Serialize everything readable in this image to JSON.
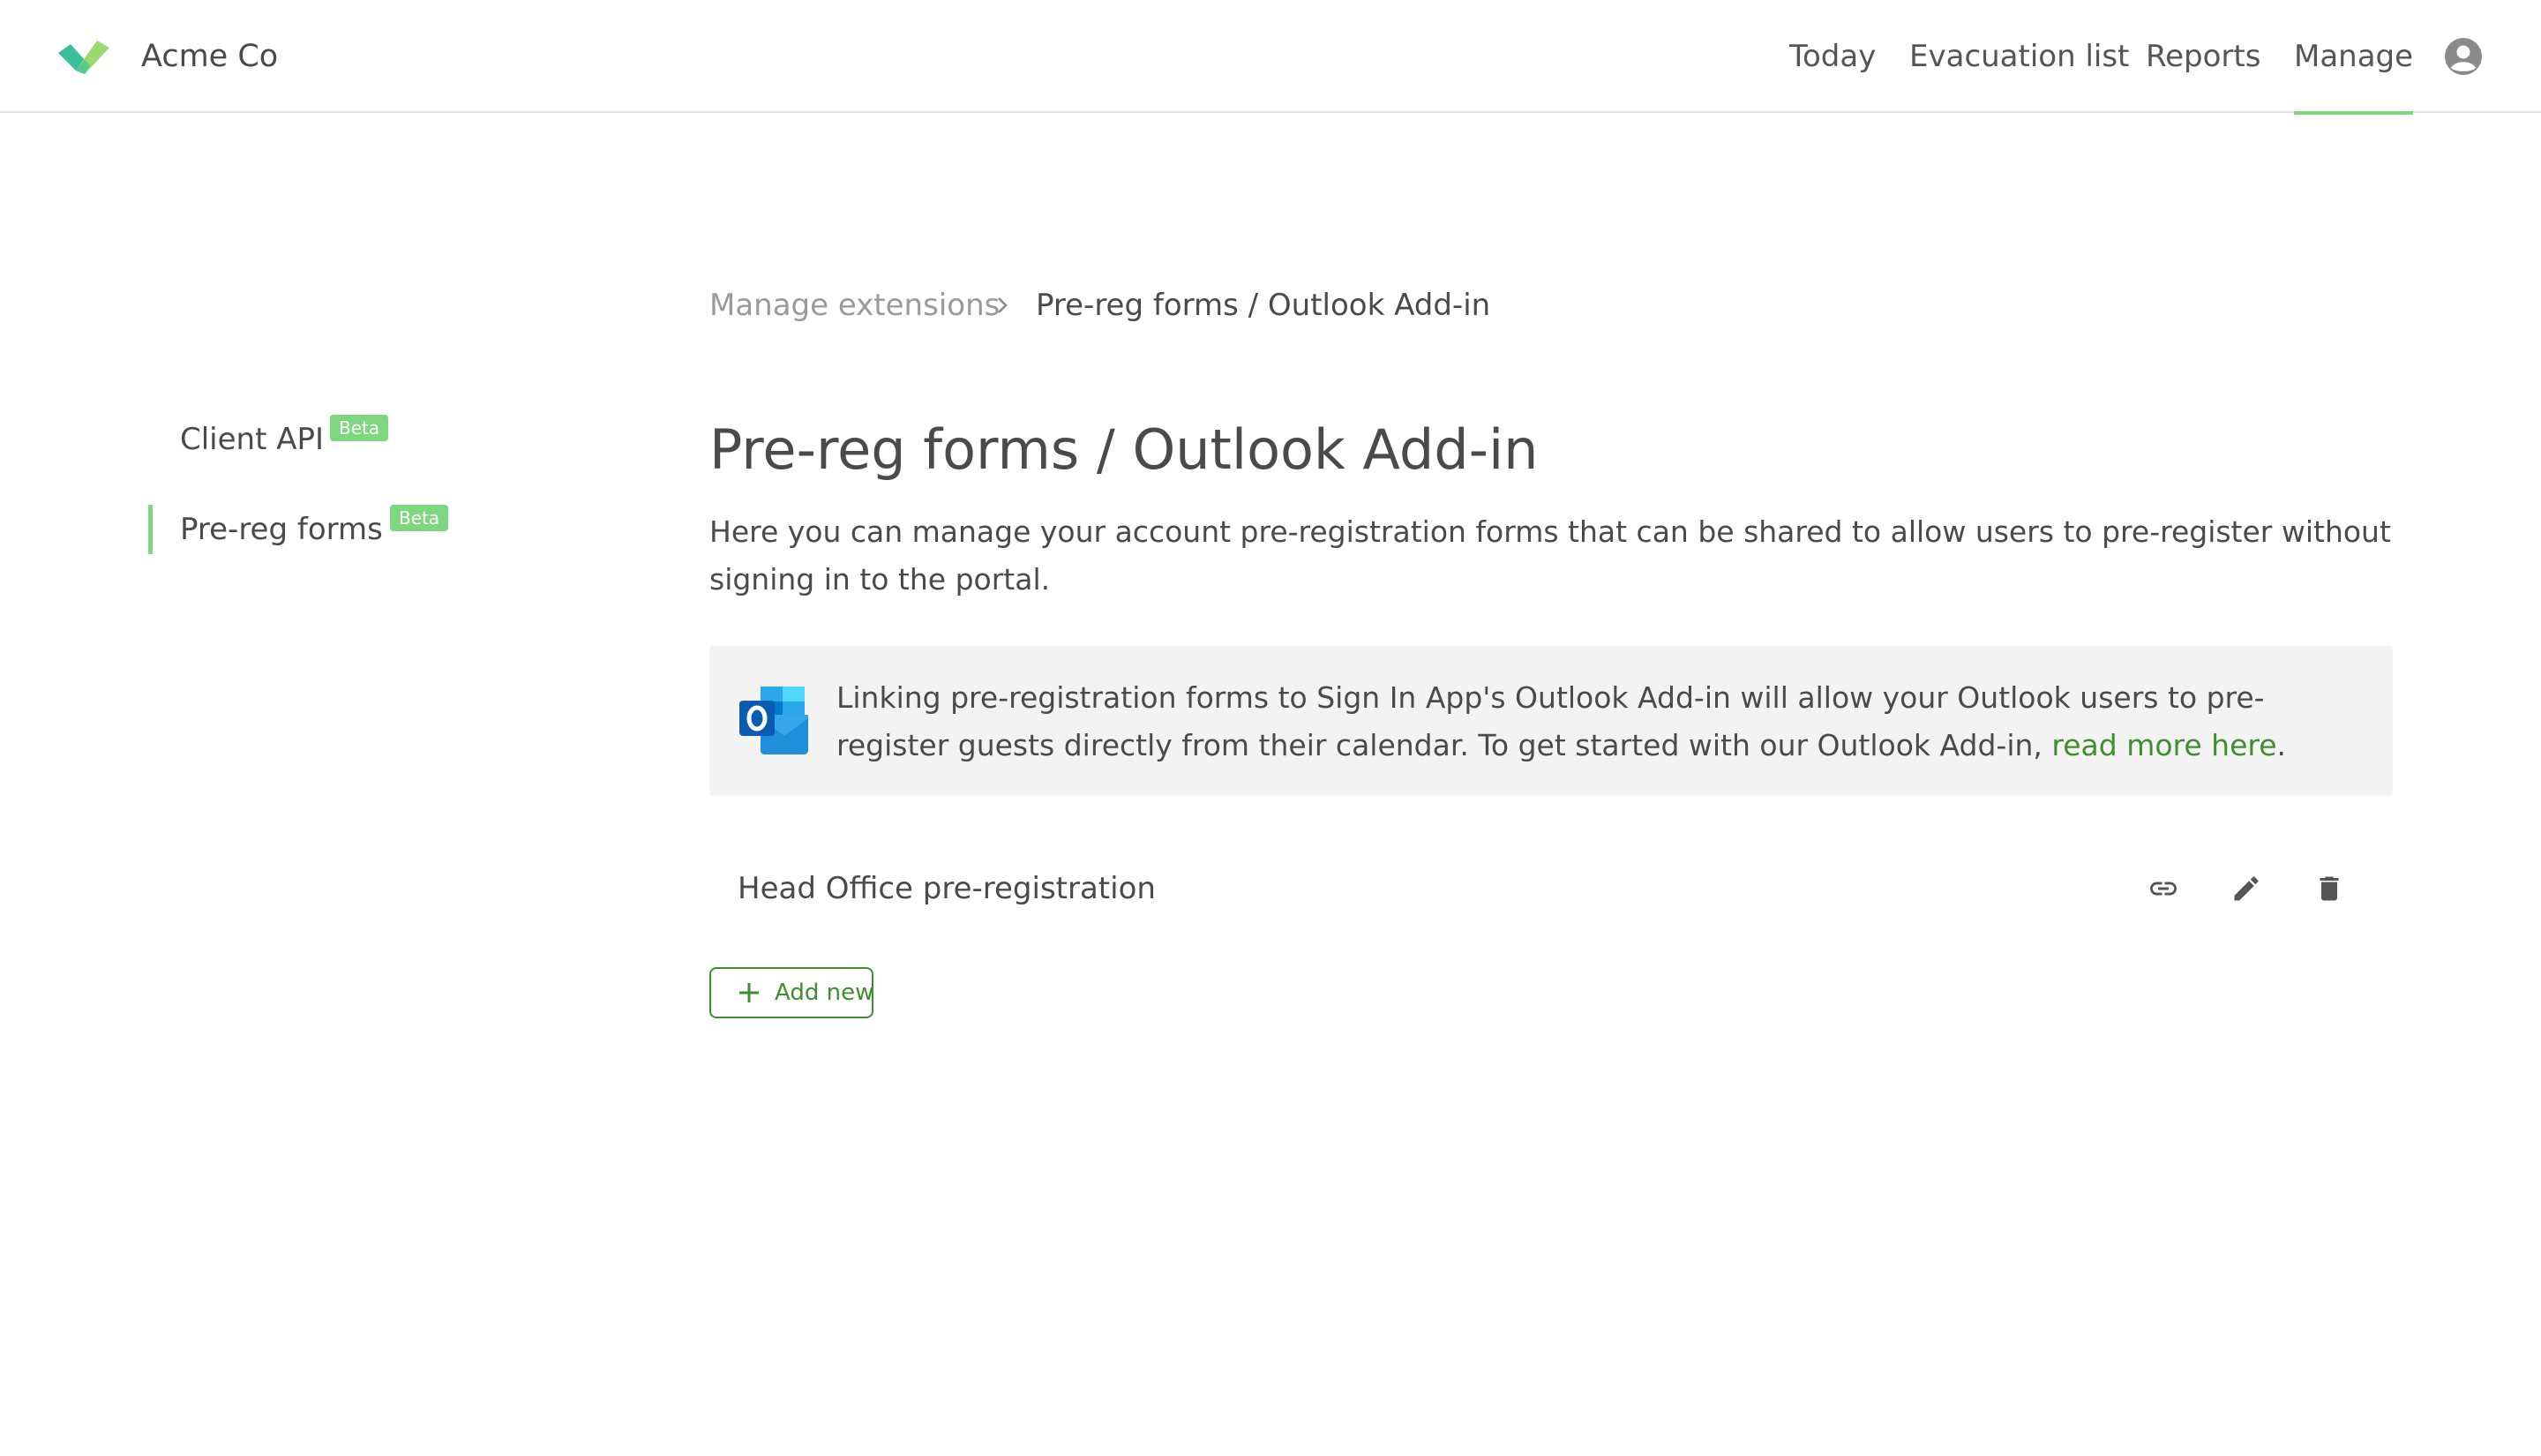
{
  "header": {
    "brand": "Acme Co",
    "nav": [
      "Today",
      "Evacuation list",
      "Reports",
      "Manage"
    ],
    "active_nav": "Manage",
    "accent_color": "#7ed67e",
    "icons": {
      "logo": "checkmark-logo",
      "account": "user-circle-icon"
    }
  },
  "breadcrumb": {
    "parent": "Manage extensions",
    "current": "Pre-reg forms / Outlook Add-in"
  },
  "sidebar": {
    "items": [
      {
        "label": "Client API",
        "badge": "Beta",
        "active": false
      },
      {
        "label": "Pre-reg forms",
        "badge": "Beta",
        "active": true
      }
    ]
  },
  "main": {
    "title": "Pre-reg forms / Outlook Add-in",
    "intro": "Here you can manage your account pre-registration forms that can be shared to allow users to pre-register without signing in to the portal.",
    "info": {
      "text": "Linking pre-registration forms to Sign In App's Outlook Add-in will allow your Outlook users to pre-register guests directly from their calendar. To get started with our Outlook Add-in, ",
      "link": "read more here",
      "suffix": ".",
      "icon": "outlook-icon"
    },
    "forms": [
      {
        "name": "Head Office pre-registration",
        "actions": [
          "link-icon",
          "edit-icon",
          "delete-icon"
        ]
      }
    ],
    "add_button": "Add new",
    "link_color": "#3f8f2f"
  }
}
